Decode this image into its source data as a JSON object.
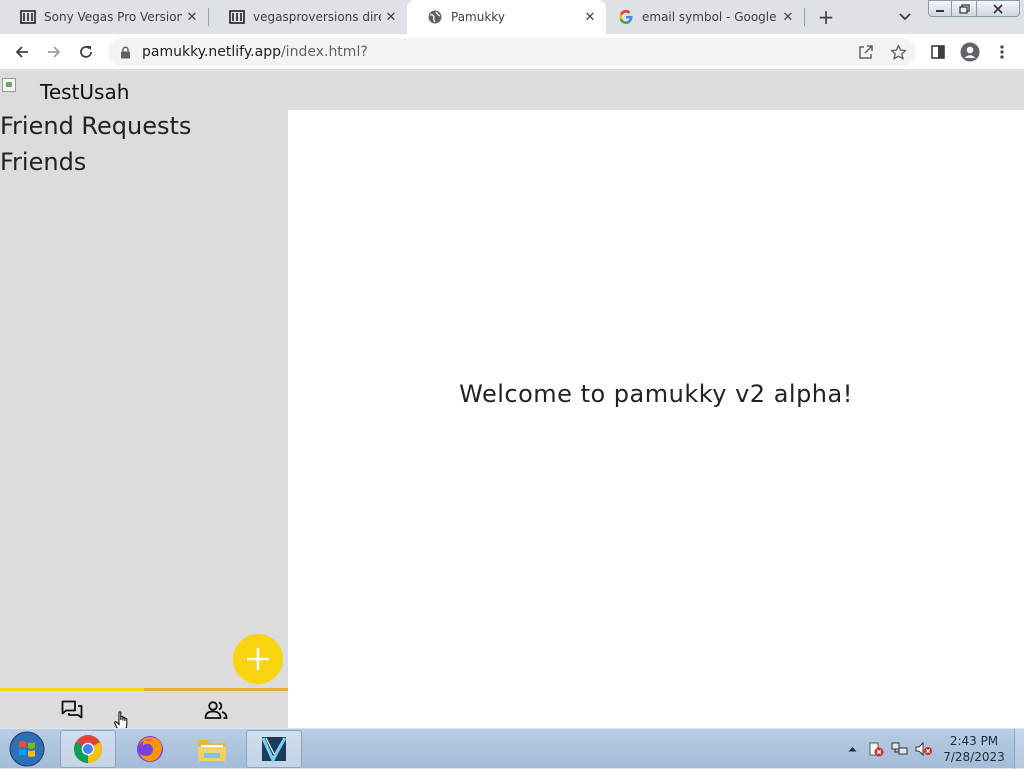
{
  "browser": {
    "tabs": [
      {
        "title": "Sony Vegas Pro Versions",
        "icon": "archive-icon",
        "active": false
      },
      {
        "title": "vegasproversions directo",
        "icon": "archive-icon",
        "active": false
      },
      {
        "title": "Pamukky",
        "icon": "globe-icon",
        "active": true
      },
      {
        "title": "email symbol - Google Se",
        "icon": "google-icon",
        "active": false
      }
    ],
    "url_host": "pamukky.netlify.app",
    "url_path": "/index.html?"
  },
  "app": {
    "username": "TestUsah",
    "nav": {
      "friend_requests": "Friend Requests",
      "friends": "Friends"
    },
    "welcome": "Welcome to pamukky v2 alpha!",
    "bottom_tabs": [
      {
        "name": "chats",
        "icon": "chat-icon",
        "active": true
      },
      {
        "name": "people",
        "icon": "people-icon",
        "active": false
      }
    ],
    "colors": {
      "accent": "#f7d310",
      "sidebar_bg": "#dcdcdc",
      "main_bg": "#ffffff"
    }
  },
  "taskbar": {
    "apps": [
      "chrome-icon",
      "firefox-icon",
      "file-explorer-icon",
      "video-editor-icon"
    ],
    "time": "2:43 PM",
    "date": "7/28/2023"
  }
}
